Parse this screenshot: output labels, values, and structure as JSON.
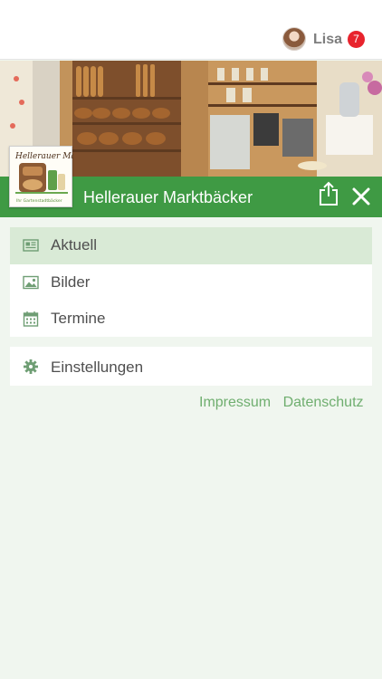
{
  "header": {
    "user_name": "Lisa",
    "notification_count": "7"
  },
  "brand": {
    "name": "Hellerauer Marktbäcker",
    "logo_text_top": "Hellerauer Markt",
    "logo_text_bottom": "Ihr Gartenstadtbäcker"
  },
  "menu": {
    "items": [
      {
        "label": "Aktuell",
        "icon": "newspaper-icon",
        "active": true
      },
      {
        "label": "Bilder",
        "icon": "image-icon",
        "active": false
      },
      {
        "label": "Termine",
        "icon": "calendar-icon",
        "active": false
      }
    ],
    "settings_label": "Einstellungen"
  },
  "footer": {
    "impressum": "Impressum",
    "datenschutz": "Datenschutz"
  },
  "colors": {
    "brand_green": "#3f9a44",
    "active_item": "#d9ead6",
    "link_green": "#6fae6f",
    "badge_red": "#e8232d",
    "background": "#f0f6ef"
  }
}
